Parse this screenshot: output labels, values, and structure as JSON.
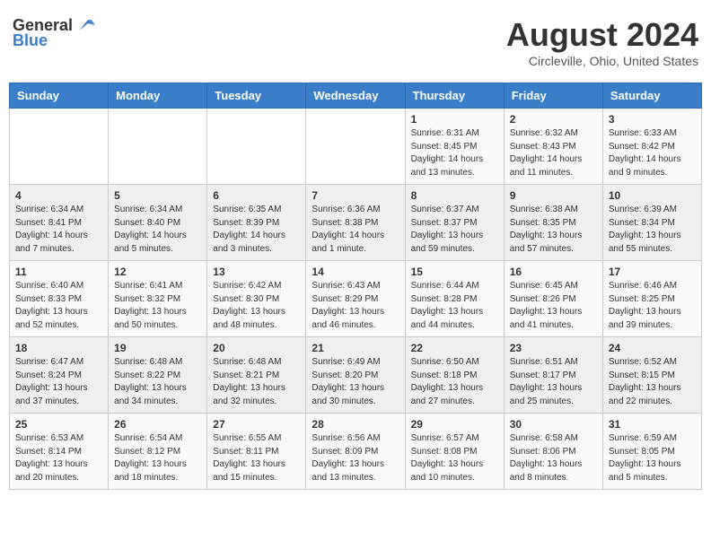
{
  "logo": {
    "line1": "General",
    "line2": "Blue"
  },
  "title": "August 2024",
  "subtitle": "Circleville, Ohio, United States",
  "days_of_week": [
    "Sunday",
    "Monday",
    "Tuesday",
    "Wednesday",
    "Thursday",
    "Friday",
    "Saturday"
  ],
  "weeks": [
    [
      {
        "day": "",
        "info": ""
      },
      {
        "day": "",
        "info": ""
      },
      {
        "day": "",
        "info": ""
      },
      {
        "day": "",
        "info": ""
      },
      {
        "day": "1",
        "info": "Sunrise: 6:31 AM\nSunset: 8:45 PM\nDaylight: 14 hours and 13 minutes."
      },
      {
        "day": "2",
        "info": "Sunrise: 6:32 AM\nSunset: 8:43 PM\nDaylight: 14 hours and 11 minutes."
      },
      {
        "day": "3",
        "info": "Sunrise: 6:33 AM\nSunset: 8:42 PM\nDaylight: 14 hours and 9 minutes."
      }
    ],
    [
      {
        "day": "4",
        "info": "Sunrise: 6:34 AM\nSunset: 8:41 PM\nDaylight: 14 hours and 7 minutes."
      },
      {
        "day": "5",
        "info": "Sunrise: 6:34 AM\nSunset: 8:40 PM\nDaylight: 14 hours and 5 minutes."
      },
      {
        "day": "6",
        "info": "Sunrise: 6:35 AM\nSunset: 8:39 PM\nDaylight: 14 hours and 3 minutes."
      },
      {
        "day": "7",
        "info": "Sunrise: 6:36 AM\nSunset: 8:38 PM\nDaylight: 14 hours and 1 minute."
      },
      {
        "day": "8",
        "info": "Sunrise: 6:37 AM\nSunset: 8:37 PM\nDaylight: 13 hours and 59 minutes."
      },
      {
        "day": "9",
        "info": "Sunrise: 6:38 AM\nSunset: 8:35 PM\nDaylight: 13 hours and 57 minutes."
      },
      {
        "day": "10",
        "info": "Sunrise: 6:39 AM\nSunset: 8:34 PM\nDaylight: 13 hours and 55 minutes."
      }
    ],
    [
      {
        "day": "11",
        "info": "Sunrise: 6:40 AM\nSunset: 8:33 PM\nDaylight: 13 hours and 52 minutes."
      },
      {
        "day": "12",
        "info": "Sunrise: 6:41 AM\nSunset: 8:32 PM\nDaylight: 13 hours and 50 minutes."
      },
      {
        "day": "13",
        "info": "Sunrise: 6:42 AM\nSunset: 8:30 PM\nDaylight: 13 hours and 48 minutes."
      },
      {
        "day": "14",
        "info": "Sunrise: 6:43 AM\nSunset: 8:29 PM\nDaylight: 13 hours and 46 minutes."
      },
      {
        "day": "15",
        "info": "Sunrise: 6:44 AM\nSunset: 8:28 PM\nDaylight: 13 hours and 44 minutes."
      },
      {
        "day": "16",
        "info": "Sunrise: 6:45 AM\nSunset: 8:26 PM\nDaylight: 13 hours and 41 minutes."
      },
      {
        "day": "17",
        "info": "Sunrise: 6:46 AM\nSunset: 8:25 PM\nDaylight: 13 hours and 39 minutes."
      }
    ],
    [
      {
        "day": "18",
        "info": "Sunrise: 6:47 AM\nSunset: 8:24 PM\nDaylight: 13 hours and 37 minutes."
      },
      {
        "day": "19",
        "info": "Sunrise: 6:48 AM\nSunset: 8:22 PM\nDaylight: 13 hours and 34 minutes."
      },
      {
        "day": "20",
        "info": "Sunrise: 6:48 AM\nSunset: 8:21 PM\nDaylight: 13 hours and 32 minutes."
      },
      {
        "day": "21",
        "info": "Sunrise: 6:49 AM\nSunset: 8:20 PM\nDaylight: 13 hours and 30 minutes."
      },
      {
        "day": "22",
        "info": "Sunrise: 6:50 AM\nSunset: 8:18 PM\nDaylight: 13 hours and 27 minutes."
      },
      {
        "day": "23",
        "info": "Sunrise: 6:51 AM\nSunset: 8:17 PM\nDaylight: 13 hours and 25 minutes."
      },
      {
        "day": "24",
        "info": "Sunrise: 6:52 AM\nSunset: 8:15 PM\nDaylight: 13 hours and 22 minutes."
      }
    ],
    [
      {
        "day": "25",
        "info": "Sunrise: 6:53 AM\nSunset: 8:14 PM\nDaylight: 13 hours and 20 minutes."
      },
      {
        "day": "26",
        "info": "Sunrise: 6:54 AM\nSunset: 8:12 PM\nDaylight: 13 hours and 18 minutes."
      },
      {
        "day": "27",
        "info": "Sunrise: 6:55 AM\nSunset: 8:11 PM\nDaylight: 13 hours and 15 minutes."
      },
      {
        "day": "28",
        "info": "Sunrise: 6:56 AM\nSunset: 8:09 PM\nDaylight: 13 hours and 13 minutes."
      },
      {
        "day": "29",
        "info": "Sunrise: 6:57 AM\nSunset: 8:08 PM\nDaylight: 13 hours and 10 minutes."
      },
      {
        "day": "30",
        "info": "Sunrise: 6:58 AM\nSunset: 8:06 PM\nDaylight: 13 hours and 8 minutes."
      },
      {
        "day": "31",
        "info": "Sunrise: 6:59 AM\nSunset: 8:05 PM\nDaylight: 13 hours and 5 minutes."
      }
    ]
  ]
}
